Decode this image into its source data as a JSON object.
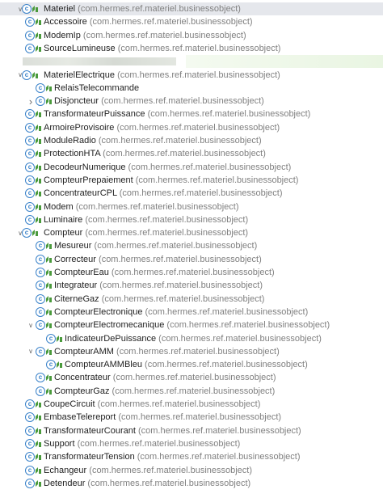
{
  "package": "(com.hermes.ref.materiel.businessobject)",
  "icons": {
    "class": "class-icon",
    "badge": "leaf-badge-icon",
    "expand": "chevron-icon"
  },
  "colors": {
    "class_icon": "#3a82c9",
    "badge": "#4a9a3c",
    "selected_row": "#e5e7ec",
    "package_text": "#808080"
  },
  "tree": [
    {
      "name": "Materiel",
      "indent": 0,
      "state": "expanded",
      "pkg": true,
      "selected": true
    },
    {
      "name": "Accessoire",
      "indent": 1,
      "state": "leaf",
      "pkg": true
    },
    {
      "name": "ModemIp",
      "indent": 1,
      "state": "leaf",
      "pkg": true
    },
    {
      "name": "SourceLumineuse",
      "indent": 1,
      "state": "leaf",
      "pkg": true
    },
    {
      "name": "",
      "indent": 1,
      "state": "blur",
      "pkg": false
    },
    {
      "name": "MaterielElectrique",
      "indent": 0,
      "state": "expanded",
      "pkg": true
    },
    {
      "name": "RelaisTelecommande",
      "indent": 2,
      "state": "leaf",
      "pkg": false
    },
    {
      "name": "Disjoncteur",
      "indent": 2,
      "state": "collapsed",
      "pkg": true
    },
    {
      "name": "TransformateurPuissance",
      "indent": 1,
      "state": "leaf",
      "pkg": true
    },
    {
      "name": "ArmoireProvisoire",
      "indent": 1,
      "state": "leaf",
      "pkg": true
    },
    {
      "name": "ModuleRadio",
      "indent": 1,
      "state": "leaf",
      "pkg": true
    },
    {
      "name": "ProtectionHTA",
      "indent": 1,
      "state": "leaf",
      "pkg": true
    },
    {
      "name": "DecodeurNumerique",
      "indent": 1,
      "state": "leaf",
      "pkg": true
    },
    {
      "name": "CompteurPrepaiement",
      "indent": 1,
      "state": "leaf",
      "pkg": true
    },
    {
      "name": "ConcentrateurCPL",
      "indent": 1,
      "state": "leaf",
      "pkg": true
    },
    {
      "name": "Modem",
      "indent": 1,
      "state": "leaf",
      "pkg": true
    },
    {
      "name": "Luminaire",
      "indent": 1,
      "state": "leaf",
      "pkg": true
    },
    {
      "name": "Compteur",
      "indent": 0,
      "state": "expanded",
      "pkg": true
    },
    {
      "name": "Mesureur",
      "indent": 2,
      "state": "leaf",
      "pkg": true
    },
    {
      "name": "Correcteur",
      "indent": 2,
      "state": "leaf",
      "pkg": true
    },
    {
      "name": "CompteurEau",
      "indent": 2,
      "state": "leaf",
      "pkg": true
    },
    {
      "name": "Integrateur",
      "indent": 2,
      "state": "leaf",
      "pkg": true
    },
    {
      "name": "CiterneGaz",
      "indent": 2,
      "state": "leaf",
      "pkg": true
    },
    {
      "name": "CompteurElectronique",
      "indent": 2,
      "state": "leaf",
      "pkg": true
    },
    {
      "name": "CompteurElectromecanique",
      "indent": 2,
      "state": "expanded",
      "pkg": true
    },
    {
      "name": "IndicateurDePuissance",
      "indent": 3,
      "state": "leaf",
      "pkg": true
    },
    {
      "name": "CompteurAMM",
      "indent": 2,
      "state": "expanded",
      "pkg": true
    },
    {
      "name": "CompteurAMMBleu",
      "indent": 3,
      "state": "leaf",
      "pkg": true
    },
    {
      "name": "Concentrateur",
      "indent": 2,
      "state": "leaf",
      "pkg": true
    },
    {
      "name": "CompteurGaz",
      "indent": 2,
      "state": "leaf",
      "pkg": true
    },
    {
      "name": "CoupeCircuit",
      "indent": 1,
      "state": "leaf",
      "pkg": true
    },
    {
      "name": "EmbaseTelereport",
      "indent": 1,
      "state": "leaf",
      "pkg": true
    },
    {
      "name": "TransformateurCourant",
      "indent": 1,
      "state": "leaf",
      "pkg": true
    },
    {
      "name": "Support",
      "indent": 1,
      "state": "leaf",
      "pkg": true
    },
    {
      "name": "TransformateurTension",
      "indent": 1,
      "state": "leaf",
      "pkg": true
    },
    {
      "name": "Echangeur",
      "indent": 1,
      "state": "leaf",
      "pkg": true
    },
    {
      "name": "Detendeur",
      "indent": 1,
      "state": "leaf",
      "pkg": true
    }
  ]
}
